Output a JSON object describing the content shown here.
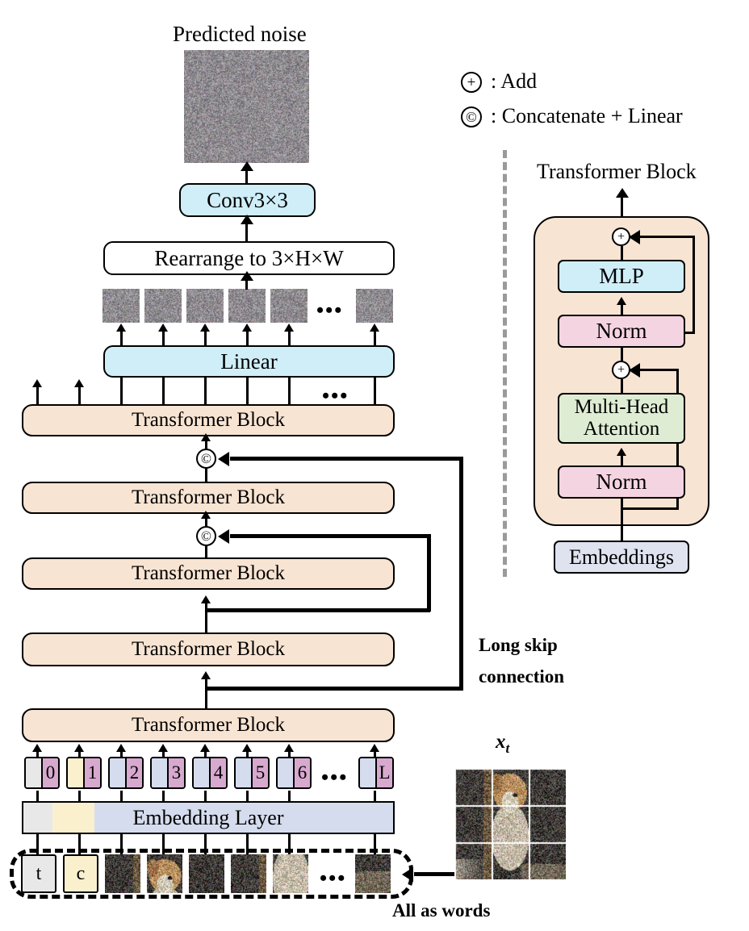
{
  "figure": {
    "title_predicted_noise": "Predicted noise",
    "input_label": "x_t",
    "all_as_words": "All as words",
    "long_skip_connection_line1": "Long skip",
    "long_skip_connection_line2": "connection"
  },
  "legend": {
    "add_symbol": "⊕",
    "add_label": ": Add",
    "concat_symbol": "©",
    "concat_label": ": Concatenate + Linear"
  },
  "main_stack": {
    "conv": "Conv3×3",
    "rearrange": "Rearrange to 3×H×W",
    "linear": "Linear",
    "transformer_block": "Transformer Block",
    "transformer_block_count": 5,
    "embedding_layer": "Embedding Layer",
    "ellipsis": "•••"
  },
  "tokens": {
    "position_labels": [
      "0",
      "1",
      "2",
      "3",
      "4",
      "5",
      "6",
      "L"
    ],
    "word_labels": [
      "t",
      "c"
    ],
    "ellipsis": "•••"
  },
  "transformer_detail": {
    "title": "Transformer Block",
    "mlp": "MLP",
    "norm_top": "Norm",
    "attention_line1": "Multi-Head",
    "attention_line2": "Attention",
    "norm_bottom": "Norm",
    "embeddings": "Embeddings",
    "add_symbol": "+"
  },
  "colors": {
    "transformer_block": "#F8E4D2",
    "linear_cyan": "#CFEEF8",
    "norm_pink": "#F5D4E1",
    "attention_green": "#DFECD4",
    "embeddings_lavender": "#DFE2EF",
    "token_position_purple": "#D7A9CF",
    "token_t_gray": "#E8E8E8",
    "token_c_yellow": "#FBF0CE",
    "token_patch_blue": "#D5DCEE",
    "divider_gray": "#9A9A9A"
  }
}
